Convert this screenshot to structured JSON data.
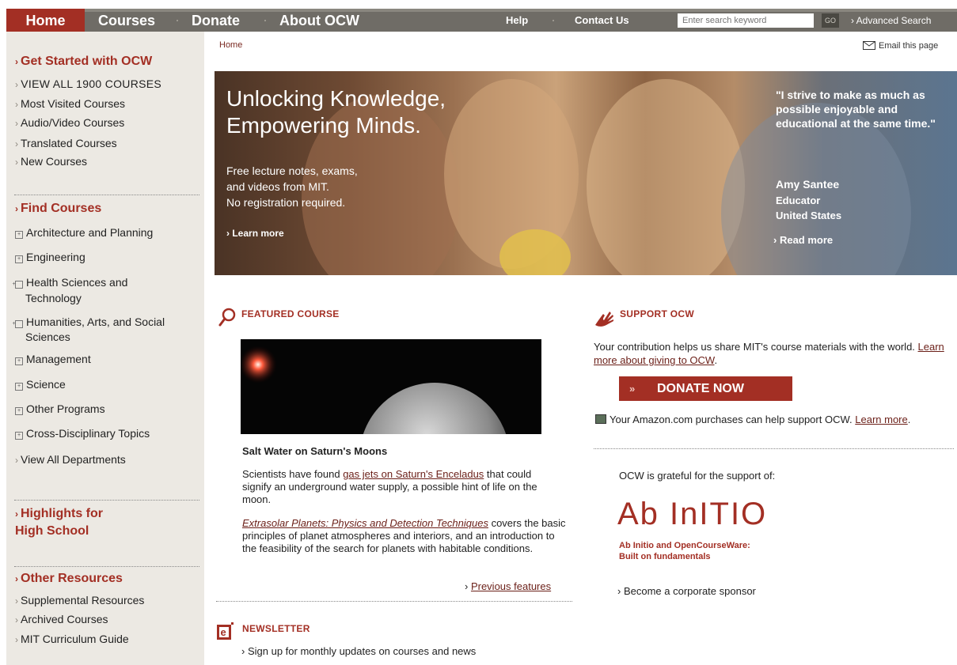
{
  "top_nav": {
    "items": [
      "Home",
      "Courses",
      "Donate",
      "About OCW"
    ],
    "help": "Help",
    "contact": "Contact Us",
    "search_placeholder": "Enter search keyword",
    "search_go": "GO",
    "advanced_search": "Advanced Search"
  },
  "sidebar": {
    "get_started": {
      "heading": "Get Started with OCW",
      "links": [
        "VIEW ALL 1900 COURSES",
        "Most Visited Courses",
        "Audio/Video Courses",
        "Translated Courses",
        "New Courses"
      ]
    },
    "find_courses": {
      "heading": "Find Courses",
      "departments": [
        "Architecture and Planning",
        "Engineering",
        "Health Sciences and Technology",
        "Humanities, Arts, and Social Sciences",
        "Management",
        "Science",
        "Other Programs",
        "Cross-Disciplinary Topics"
      ],
      "view_all": "View All Departments"
    },
    "highlights": {
      "line1": "Highlights for",
      "line2": "High School"
    },
    "other_resources": {
      "heading": "Other Resources",
      "links": [
        "Supplemental Resources",
        "Archived Courses",
        "MIT Curriculum Guide"
      ]
    }
  },
  "breadcrumb": "Home",
  "email_page": "Email this page",
  "hero": {
    "title_line1": "Unlocking Knowledge,",
    "title_line2": "Empowering Minds.",
    "sub_line1": "Free lecture notes, exams,",
    "sub_line2": "and videos from MIT.",
    "sub_line3": "No registration required.",
    "learn_more": "Learn more",
    "quote": "\"I strive to make as much as possible enjoyable and educational at the same time.\"",
    "name": "Amy Santee",
    "role": "Educator",
    "country": "United States",
    "read_more": "Read more"
  },
  "featured": {
    "heading": "FEATURED COURSE",
    "title": "Salt Water on Saturn's Moons",
    "desc_before": "Scientists have found ",
    "desc_link": "gas jets on Saturn's Enceladus",
    "desc_after": " that could signify an underground water supply, a possible hint of life on the moon.",
    "course_link": "Extrasolar Planets: Physics and Detection Techniques",
    "course_desc": " covers the basic principles of planet atmospheres and interiors, and an introduction to the feasibility of the search for planets with habitable conditions.",
    "previous": "Previous features"
  },
  "newsletter": {
    "heading": "NEWSLETTER",
    "link": "Sign up for monthly updates on courses and news"
  },
  "support": {
    "heading": "SUPPORT OCW",
    "text": "Your contribution helps us share MIT's course materials with the world. ",
    "text_link": "Learn more about giving to OCW",
    "text_end": ".",
    "donate_arrows": "»",
    "donate_label": "DONATE NOW",
    "amazon_text": "Your Amazon.com purchases can help support OCW. ",
    "amazon_link": "Learn more",
    "amazon_end": ".",
    "grateful": "OCW is grateful for the support of:",
    "sponsor_logo": "Ab InITIO",
    "sponsor_caption_1": "Ab Initio and OpenCourseWare:",
    "sponsor_caption_2": "Built on fundamentals",
    "become_sponsor": "Become a corporate sponsor"
  },
  "colors": {
    "brand": "#a32f24",
    "nav_bg": "#6f6c66",
    "sidebar_bg": "#ece9e3"
  }
}
